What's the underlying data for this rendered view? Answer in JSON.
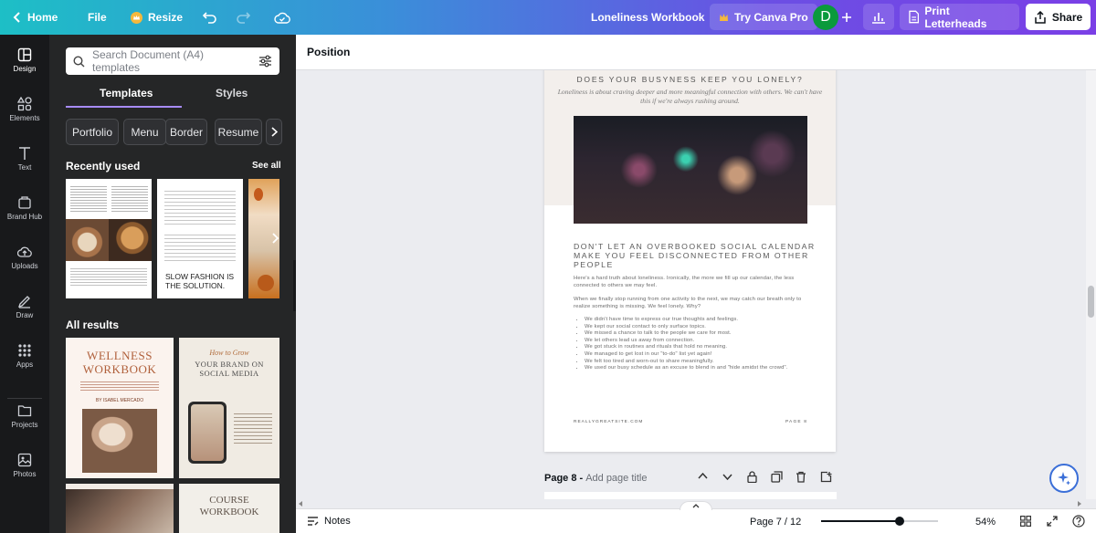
{
  "topbar": {
    "home_label": "Home",
    "file_label": "File",
    "resize_label": "Resize",
    "doc_title": "Loneliness Workbook",
    "try_pro_label": "Try Canva Pro",
    "avatar_initial": "D",
    "print_label": "Print Letterheads",
    "share_label": "Share"
  },
  "rail": [
    {
      "label": "Design",
      "icon": "design-icon"
    },
    {
      "label": "Elements",
      "icon": "elements-icon"
    },
    {
      "label": "Text",
      "icon": "text-icon"
    },
    {
      "label": "Brand Hub",
      "icon": "brand-hub-icon"
    },
    {
      "label": "Uploads",
      "icon": "uploads-icon"
    },
    {
      "label": "Draw",
      "icon": "draw-icon"
    },
    {
      "label": "Apps",
      "icon": "apps-icon"
    },
    {
      "label": "Projects",
      "icon": "projects-icon"
    },
    {
      "label": "Photos",
      "icon": "photos-icon"
    }
  ],
  "panel": {
    "search_placeholder": "Search Document (A4) templates",
    "tabs": [
      "Templates",
      "Styles"
    ],
    "chips": [
      "Portfolio",
      "Menu",
      "Border",
      "Resume"
    ],
    "recently_used": "Recently used",
    "see_all": "See all",
    "all_results": "All results",
    "recent_thumb2_text": "SLOW FASHION IS THE SOLUTION.",
    "result1_title": "WELLNESS WORKBOOK",
    "result1_author": "BY ISABEL MERCADO",
    "result2_script": "How to Grow",
    "result2_title": "YOUR BRAND ON SOCIAL MEDIA",
    "result4_title": "COURSE WORKBOOK"
  },
  "context_bar": {
    "label": "Position"
  },
  "page": {
    "heading1": "DOES YOUR BUSYNESS KEEP YOU LONELY?",
    "intro": "Loneliness is about craving deeper and more meaningful connection with others. We can't have this if we're always rushing around.",
    "heading2": "DON'T LET AN OVERBOOKED SOCIAL CALENDAR MAKE YOU FEEL DISCONNECTED FROM OTHER PEOPLE",
    "para1": "Here's a hard truth about loneliness. Ironically, the more we fill up our calendar, the less connected to others we may feel.",
    "para2": "When we finally stop running from one activity to the next, we may catch our breath only to realize something is missing. We feel lonely. Why?",
    "bullets": [
      "We didn't have time to express our true thoughts and feelings.",
      "We kept our social contact to only surface topics.",
      "We missed a chance to talk to the people we care for most.",
      "We let others lead us away from connection.",
      "We got stuck in routines and rituals that hold no meaning.",
      "We managed to get lost in our \"to-do\" list yet again!",
      "We felt too tired and worn-out to share meaningfully.",
      "We used our busy schedule as an excuse to blend in and \"hide amidst the crowd\"."
    ],
    "footer_left": "REALLYGREATSITE.COM",
    "footer_right": "PAGE 8"
  },
  "page8": {
    "label": "Page 8 -",
    "placeholder": "Add page title"
  },
  "bottombar": {
    "notes": "Notes",
    "page_count": "Page 7 / 12",
    "zoom": "54%",
    "zoom_level": 0.54
  },
  "colors": {
    "accent": "#7d2ae8",
    "avatar": "#0a9a3c"
  }
}
